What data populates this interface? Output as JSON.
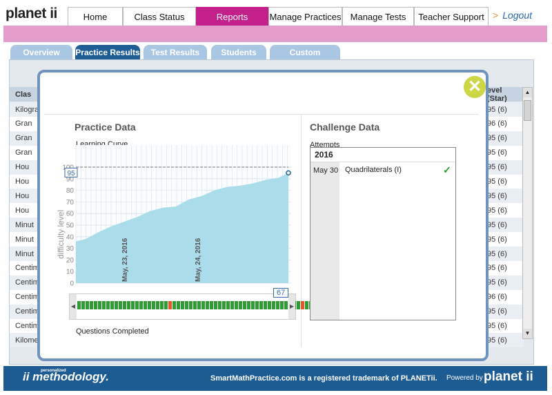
{
  "app": {
    "logo_text": "planet",
    "logo_suffix": "ii"
  },
  "nav": {
    "items": [
      {
        "label": "Home",
        "active": false
      },
      {
        "label": "Class Status",
        "active": false
      },
      {
        "label": "Reports",
        "active": true
      },
      {
        "label": "Manage Practices",
        "active": false
      },
      {
        "label": "Manage Tests",
        "active": false
      },
      {
        "label": "Teacher Support",
        "active": false
      }
    ],
    "logout": "Logout"
  },
  "subtabs": [
    {
      "label": "Overview",
      "active": false
    },
    {
      "label": "Practice Results",
      "active": true
    },
    {
      "label": "Test Results",
      "active": false
    },
    {
      "label": "Students",
      "active": false
    },
    {
      "label": "Custom",
      "active": false
    }
  ],
  "background_table": {
    "header_left": "Clas",
    "header_right": "evel (Star)",
    "rows": [
      {
        "left": "Kilogra",
        "right": "95 (6)"
      },
      {
        "left": "Gran",
        "right": "96 (6)"
      },
      {
        "left": "Gran",
        "right": "95 (6)"
      },
      {
        "left": "Gran",
        "right": "95 (6)"
      },
      {
        "left": "Hou",
        "right": "95 (6)"
      },
      {
        "left": "Hou",
        "right": "95 (6)"
      },
      {
        "left": "Hou",
        "right": "95 (6)"
      },
      {
        "left": "Hou",
        "right": "95 (6)"
      },
      {
        "left": "Minut",
        "right": "95 (6)"
      },
      {
        "left": "Minut",
        "right": "95 (6)"
      },
      {
        "left": "Minut",
        "right": "95 (6)"
      },
      {
        "left": "Centim",
        "right": "95 (6)"
      },
      {
        "left": "Centim",
        "right": "95 (6)"
      },
      {
        "left": "Centim",
        "right": "96 (6)"
      },
      {
        "left": "Centim",
        "right": "95 (6)"
      },
      {
        "left": "Centim",
        "right": "95 (6)"
      },
      {
        "left": "Kilome",
        "right": "95 (6)"
      }
    ]
  },
  "modal": {
    "practice_title": "Practice Data",
    "learning_curve_label": "Learning Curve",
    "questions_completed_label": "Questions Completed",
    "questions_count": "67",
    "current_value_label": "95",
    "challenge_title": "Challenge Data",
    "attempts_label": "Attempts",
    "challenge_year": "2016",
    "challenge_date": "May 30",
    "challenge_name": "Quadrilaterals (I)"
  },
  "chart_data": {
    "type": "area",
    "title": "Learning Curve",
    "xlabel": "",
    "ylabel": "difficulty level",
    "ylim": [
      0,
      100
    ],
    "yticks": [
      0,
      10,
      20,
      30,
      40,
      50,
      60,
      70,
      80,
      90,
      100
    ],
    "date_markers": [
      "May, 23, 2016",
      "May, 24, 2016"
    ],
    "reference_line": 100,
    "current_value": 95,
    "x": [
      1,
      4,
      8,
      12,
      16,
      20,
      24,
      28,
      32,
      36,
      40,
      44,
      48,
      52,
      56,
      60,
      64,
      67
    ],
    "values": [
      36,
      38,
      44,
      49,
      53,
      57,
      62,
      65,
      66,
      72,
      75,
      80,
      83,
      84,
      86,
      89,
      91,
      95
    ],
    "questions": [
      "c",
      "c",
      "c",
      "c",
      "c",
      "c",
      "c",
      "c",
      "c",
      "c",
      "c",
      "c",
      "c",
      "c",
      "c",
      "c",
      "c",
      "c",
      "c",
      "c",
      "c",
      "c",
      "w",
      "c",
      "c",
      "c",
      "c",
      "c",
      "c",
      "c",
      "c",
      "c",
      "c",
      "c",
      "c",
      "c",
      "c",
      "c",
      "c",
      "c",
      "c",
      "c",
      "c",
      "c",
      "c",
      "c",
      "c",
      "c",
      "c",
      "c",
      "c",
      "c",
      "c",
      "c",
      "w",
      "c",
      "c",
      "c",
      "w",
      "c",
      "c",
      "c",
      "w",
      "c",
      "c",
      "c",
      "c"
    ]
  },
  "colors": {
    "accent": "#c3208c",
    "pink_bar": "#e49ccd",
    "navy": "#1d5b93",
    "area_fill": "#aadcea",
    "correct": "#2e9c32",
    "wrong": "#e8542c"
  },
  "footer": {
    "brand": "methodology.",
    "brand_small": "personalized",
    "trademark": "SmartMathPractice.com is a registered trademark of PLANETii.",
    "powered_by": "Powered by",
    "powered_logo": "planet ii"
  }
}
